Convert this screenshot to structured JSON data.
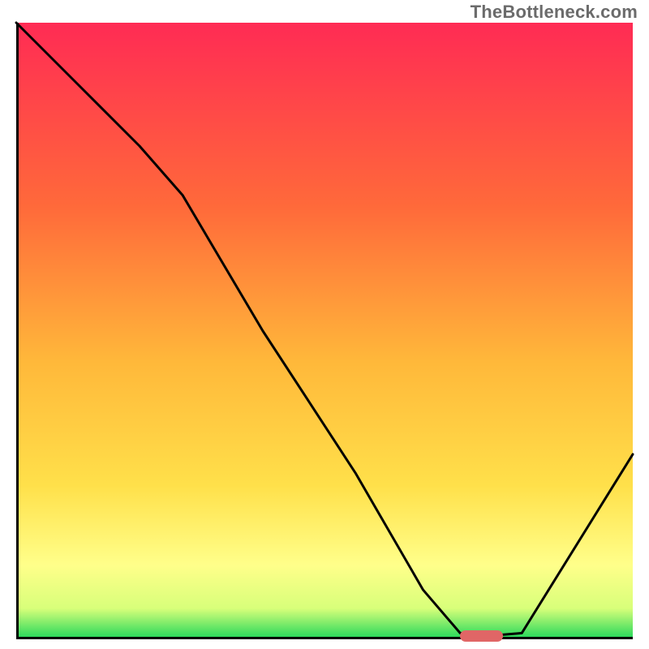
{
  "watermark": "TheBottleneck.com",
  "colors": {
    "gradient_top": "#ff2b54",
    "gradient_mid1": "#ff8a3a",
    "gradient_mid2": "#ffd93a",
    "gradient_mid3": "#ffff8a",
    "gradient_bottom": "#1fd65a",
    "curve": "#000000",
    "marker": "#e06666",
    "axis": "#000000"
  },
  "chart_data": {
    "type": "line",
    "title": "",
    "xlabel": "",
    "ylabel": "",
    "xlim": [
      0,
      100
    ],
    "ylim": [
      0,
      100
    ],
    "grid": false,
    "series": [
      {
        "name": "bottleneck-curve",
        "x": [
          0,
          10,
          20,
          27,
          40,
          55,
          66,
          72,
          76,
          82,
          100
        ],
        "y": [
          100,
          90,
          80,
          72,
          50,
          27,
          8,
          1,
          0.5,
          1,
          30
        ]
      }
    ],
    "optimal_range_x": [
      72,
      79
    ],
    "optimal_y": 0.5,
    "annotations": []
  }
}
